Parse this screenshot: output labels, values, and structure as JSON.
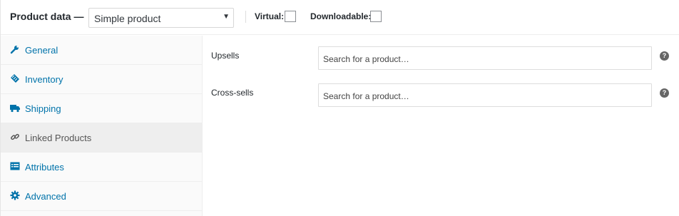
{
  "header": {
    "title": "Product data —",
    "product_type": "Simple product",
    "virtual_label": "Virtual:",
    "downloadable_label": "Downloadable:"
  },
  "sidebar": {
    "tabs": [
      {
        "label": "General",
        "icon": "wrench-icon",
        "active": false
      },
      {
        "label": "Inventory",
        "icon": "tag-icon",
        "active": false
      },
      {
        "label": "Shipping",
        "icon": "truck-icon",
        "active": false
      },
      {
        "label": "Linked Products",
        "icon": "link-icon",
        "active": true
      },
      {
        "label": "Attributes",
        "icon": "list-icon",
        "active": false
      },
      {
        "label": "Advanced",
        "icon": "gear-icon",
        "active": false
      }
    ]
  },
  "main": {
    "upsells": {
      "label": "Upsells",
      "placeholder": "Search for a product…"
    },
    "crosssells": {
      "label": "Cross-sells",
      "placeholder": "Search for a product…"
    },
    "help_glyph": "?"
  },
  "colors": {
    "link": "#0073aa",
    "active_tab_bg": "#eeeeee",
    "sidebar_bg": "#fafafa"
  }
}
